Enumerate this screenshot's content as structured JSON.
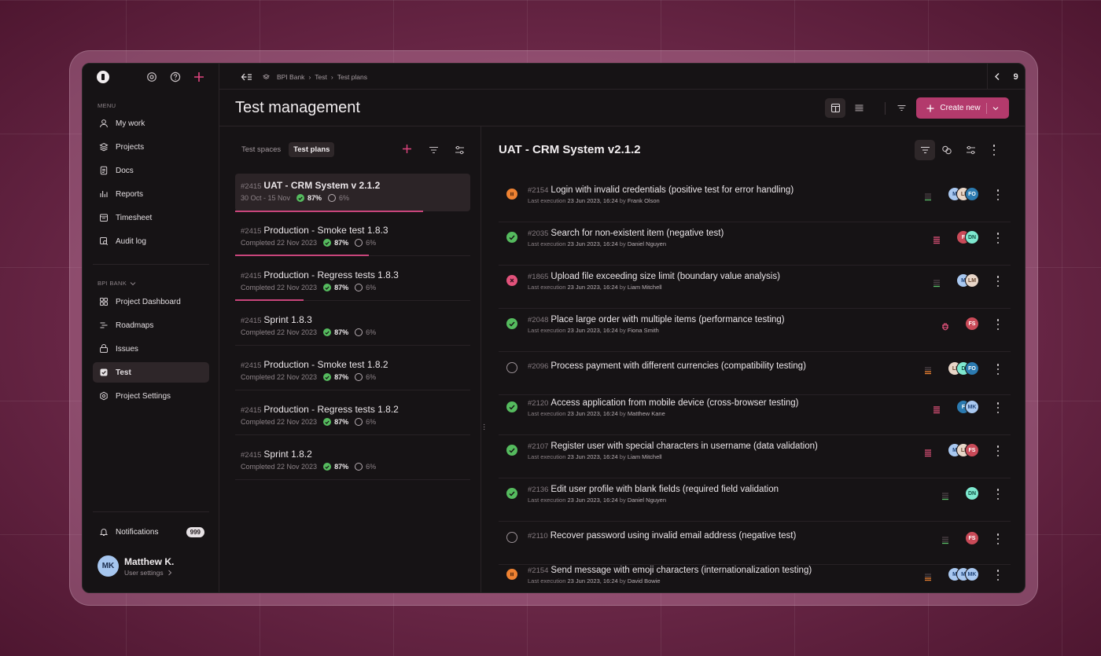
{
  "sidebar": {
    "menu_label": "MENU",
    "items": [
      {
        "label": "My work",
        "icon": "user-icon"
      },
      {
        "label": "Projects",
        "icon": "layers-icon"
      },
      {
        "label": "Docs",
        "icon": "document-icon"
      },
      {
        "label": "Reports",
        "icon": "chart-icon"
      },
      {
        "label": "Timesheet",
        "icon": "calendar-icon"
      },
      {
        "label": "Audit log",
        "icon": "audit-icon"
      }
    ],
    "section_label": "BPI BANK",
    "project_items": [
      {
        "label": "Project Dashboard",
        "icon": "dashboard-icon"
      },
      {
        "label": "Roadmaps",
        "icon": "roadmap-icon"
      },
      {
        "label": "Issues",
        "icon": "issues-icon"
      },
      {
        "label": "Test",
        "icon": "test-icon",
        "active": true
      },
      {
        "label": "Project Settings",
        "icon": "settings-icon"
      }
    ],
    "notifications": {
      "label": "Notifications",
      "count": "999"
    },
    "user": {
      "initials": "MK",
      "name": "Matthew K.",
      "sub": "User settings"
    }
  },
  "topbar": {
    "breadcrumbs": [
      "BPI Bank",
      "Test",
      "Test plans"
    ],
    "page_count": "9"
  },
  "header": {
    "title": "Test management",
    "create_label": "Create new"
  },
  "plans_panel": {
    "tabs": [
      "Test spaces",
      "Test plans"
    ],
    "active_tab": 1,
    "plans": [
      {
        "id": "#2415",
        "name": "UAT - CRM System v 2.1.2",
        "meta": "30 Oct - 15 Nov",
        "pass": "87%",
        "other": "6%",
        "progress": 0.8,
        "selected": true
      },
      {
        "id": "#2415",
        "name": "Production - Smoke test 1.8.3",
        "meta": "Completed 22 Nov 2023",
        "pass": "87%",
        "other": "6%",
        "progress": 0.57
      },
      {
        "id": "#2415",
        "name": "Production - Regress tests 1.8.3",
        "meta": "Completed 22 Nov 2023",
        "pass": "87%",
        "other": "6%",
        "progress": 0.29
      },
      {
        "id": "#2415",
        "name": "Sprint 1.8.3",
        "meta": "Completed 22 Nov 2023",
        "pass": "87%",
        "other": "6%",
        "progress": 0
      },
      {
        "id": "#2415",
        "name": "Production - Smoke test 1.8.2",
        "meta": "Completed 22 Nov 2023",
        "pass": "87%",
        "other": "6%",
        "progress": 0
      },
      {
        "id": "#2415",
        "name": "Production - Regress tests 1.8.2",
        "meta": "Completed 22 Nov 2023",
        "pass": "87%",
        "other": "6%",
        "progress": 0
      },
      {
        "id": "#2415",
        "name": "Sprint 1.8.2",
        "meta": "Completed 22 Nov 2023",
        "pass": "87%",
        "other": "6%",
        "progress": 0
      }
    ]
  },
  "detail": {
    "title": "UAT - CRM System v2.1.2",
    "cases": [
      {
        "status": "paused",
        "id": "#2154",
        "title": "Login with invalid credentials (positive test for error handling)",
        "last_label": "Last execution",
        "date": "23 Jun 2023, 16:24",
        "by": "by",
        "author": "Frank Olson",
        "priority": "low",
        "prio_color": "#5cc16a",
        "assignees": [
          {
            "i": "M",
            "c": "#a9c8f0",
            "t": "#22467a"
          },
          {
            "i": "LI",
            "c": "#e8d6c8",
            "t": "#6a4a34"
          },
          {
            "i": "FO",
            "c": "#2b7ab0",
            "t": "#ffffff"
          }
        ]
      },
      {
        "status": "passed",
        "id": "#2035",
        "title": "Search for non-existent item (negative test)",
        "last_label": "Last execution",
        "date": "23 Jun 2023, 16:24",
        "by": "by",
        "author": "Daniel Nguyen",
        "priority": "high",
        "prio_color": "#e2527b",
        "assignees": [
          {
            "i": "F",
            "c": "#c94a58",
            "t": "#ffffff"
          },
          {
            "i": "DN",
            "c": "#7ee8cf",
            "t": "#115344"
          }
        ]
      },
      {
        "status": "failed",
        "id": "#1865",
        "title": "Upload file exceeding size limit (boundary value analysis)",
        "last_label": "Last execution",
        "date": "23 Jun 2023, 16:24",
        "by": "by",
        "author": "Liam Mitchell",
        "priority": "low",
        "prio_color": "#5cc16a",
        "assignees": [
          {
            "i": "M",
            "c": "#a9c8f0",
            "t": "#22467a"
          },
          {
            "i": "LM",
            "c": "#e8d6c8",
            "t": "#6a4a34"
          }
        ]
      },
      {
        "status": "passed",
        "id": "#2048",
        "title": "Place large order with multiple items (performance testing)",
        "last_label": "Last execution",
        "date": "23 Jun 2023, 16:24",
        "by": "by",
        "author": "Fiona Smith",
        "priority": "bug",
        "prio_color": "#e2527b",
        "assignees": [
          {
            "i": "FS",
            "c": "#c94a58",
            "t": "#ffffff"
          }
        ]
      },
      {
        "status": "none",
        "id": "#2096",
        "title": "Process payment with different currencies (compatibility testing)",
        "last_label": "",
        "date": "",
        "by": "",
        "author": "",
        "priority": "medium",
        "prio_color": "#ee8232",
        "assignees": [
          {
            "i": "LI",
            "c": "#e8d6c8",
            "t": "#6a4a34"
          },
          {
            "i": "D",
            "c": "#7ee8cf",
            "t": "#115344"
          },
          {
            "i": "FO",
            "c": "#2b7ab0",
            "t": "#ffffff"
          }
        ]
      },
      {
        "status": "passed",
        "id": "#2120",
        "title": "Access application from mobile device (cross-browser testing)",
        "last_label": "Last execution",
        "date": "23 Jun 2023, 16:24",
        "by": "by",
        "author": "Matthew Kane",
        "priority": "high",
        "prio_color": "#e2527b",
        "assignees": [
          {
            "i": "F",
            "c": "#2b7ab0",
            "t": "#ffffff"
          },
          {
            "i": "MK",
            "c": "#a9c8f0",
            "t": "#22467a"
          }
        ]
      },
      {
        "status": "passed",
        "id": "#2107",
        "title": "Register user with special characters in username (data validation)",
        "last_label": "Last execution",
        "date": "23 Jun 2023, 16:24",
        "by": "by",
        "author": "Liam Mitchell",
        "priority": "high",
        "prio_color": "#e2527b",
        "assignees": [
          {
            "i": "M",
            "c": "#a9c8f0",
            "t": "#22467a"
          },
          {
            "i": "LI",
            "c": "#e8d6c8",
            "t": "#6a4a34"
          },
          {
            "i": "FS",
            "c": "#c94a58",
            "t": "#ffffff"
          }
        ]
      },
      {
        "status": "passed",
        "id": "#2136",
        "title": "Edit user profile with blank fields (required field validation",
        "last_label": "Last execution",
        "date": "23 Jun 2023, 16:24",
        "by": "by",
        "author": "Daniel Nguyen",
        "priority": "low",
        "prio_color": "#5cc16a",
        "assignees": [
          {
            "i": "DN",
            "c": "#7ee8cf",
            "t": "#115344"
          }
        ]
      },
      {
        "status": "none",
        "id": "#2110",
        "title": "Recover password using invalid email address (negative test)",
        "last_label": "",
        "date": "",
        "by": "",
        "author": "",
        "priority": "low",
        "prio_color": "#5cc16a",
        "assignees": [
          {
            "i": "FS",
            "c": "#c94a58",
            "t": "#ffffff"
          }
        ]
      },
      {
        "status": "paused",
        "id": "#2154",
        "title": "Send message with emoji characters (internationalization testing)",
        "last_label": "Last execution",
        "date": "23 Jun 2023, 16:24",
        "by": "by",
        "author": "David Bowie",
        "priority": "medium",
        "prio_color": "#ee8232",
        "assignees": [
          {
            "i": "M",
            "c": "#a9c8f0",
            "t": "#22467a"
          },
          {
            "i": "M",
            "c": "#a9c8f0",
            "t": "#22467a"
          },
          {
            "i": "MK",
            "c": "#a9c8f0",
            "t": "#22467a"
          }
        ]
      }
    ]
  }
}
